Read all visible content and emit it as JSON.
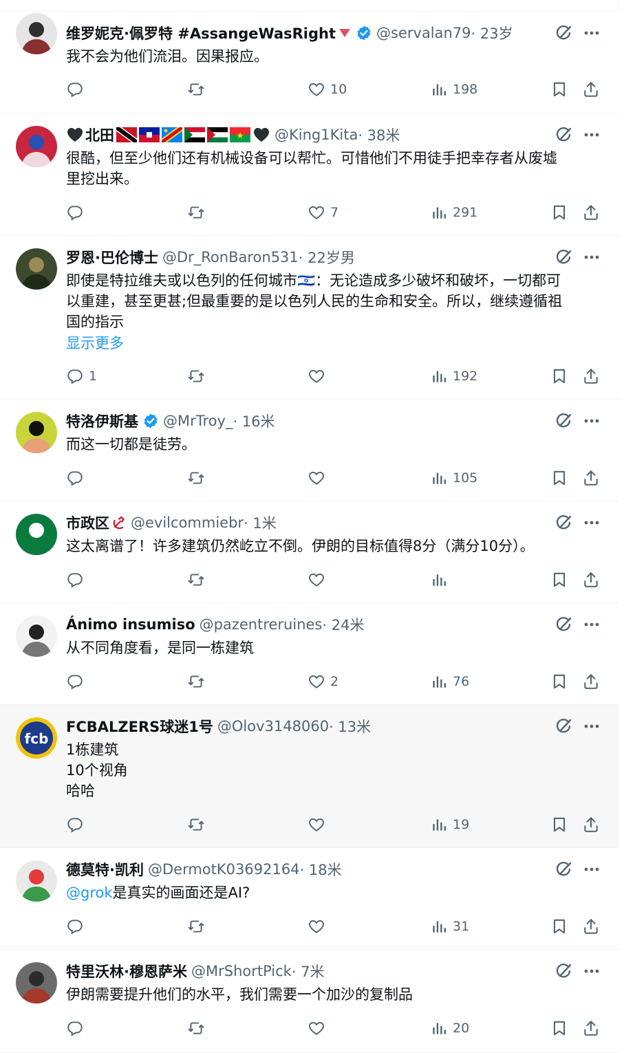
{
  "replies": [
    {
      "name": "维罗妮克·佩罗特 #AssangeWasRight",
      "name_emoji": [
        "red-triangle"
      ],
      "verified": true,
      "handle": "@servalan79",
      "time": " · 23岁",
      "text": "我不会为他们流泪。因果报应。",
      "replies_count": "",
      "likes": "10",
      "views": "198",
      "avatar_colors": [
        "#e5e5e5",
        "#2f2f2f",
        "#8a2f2f"
      ]
    },
    {
      "name_prefix": "🖤",
      "name": "北田",
      "name_emoji": [
        "flag-tt",
        "flag-ht",
        "flag-cd",
        "flag-sd",
        "flag-ps",
        "flag-bf",
        "black-heart"
      ],
      "verified": false,
      "handle": "@King1Kita",
      "time": " · 38米",
      "text": "很酷，但至少他们还有机械设备可以帮忙。可惜他们不用徒手把幸存者从废墟\n里挖出来。",
      "replies_count": "",
      "likes": "7",
      "views": "291",
      "avatar_colors": [
        "#c7263e",
        "#2951b5",
        "#f0d8e0"
      ]
    },
    {
      "name": "罗恩·巴伦博士",
      "verified": false,
      "handle": "@Dr_RonBaron531",
      "time": " · 22岁男",
      "text": "即使是特拉维夫或以色列的任何城市🇮🇱：无论造成多少破坏和破坏，一切都可\n以重建，甚至更甚;但最重要的是以色列人民的生命和安全。所以，继续遵循祖\n国的指示",
      "show_more": "显示更多",
      "replies_count": "1",
      "likes": "",
      "views": "192",
      "avatar_colors": [
        "#3d4a2e",
        "#9a8a55",
        "#1f2a17"
      ]
    },
    {
      "name": "特洛伊斯基",
      "verified": true,
      "handle": "@MrTroy_",
      "time": " · 16米",
      "text": "而这一切都是徒劳。",
      "replies_count": "",
      "likes": "",
      "views": "105",
      "avatar_colors": [
        "#c8d43a",
        "#111111",
        "#e8a077"
      ]
    },
    {
      "name": "市政区",
      "name_emoji": [
        "hammer-sickle"
      ],
      "verified": false,
      "handle": "@evilcommiebr",
      "time": " · 1米",
      "text": "这太离谱了！许多建筑仍然屹立不倒。伊朗的目标值得8分（满分10分）。",
      "replies_count": "",
      "likes": "",
      "views": "",
      "avatar_colors": [
        "#0b7a3e",
        "#ffffff",
        "#0b7a3e"
      ]
    },
    {
      "name": "Ánimo insumiso",
      "verified": false,
      "handle": "@pazentreruines",
      "time": " · 24米",
      "text": "从不同角度看，是同一栋建筑",
      "replies_count": "",
      "likes": "2",
      "views": "76",
      "avatar_colors": [
        "#f2f2f2",
        "#222222",
        "#777777"
      ]
    },
    {
      "name": "FCBALZERS球迷1号",
      "verified": false,
      "handle": "@Olov3148060",
      "time": " · 13米",
      "text": "1栋建筑\n10个视角\n哈哈",
      "replies_count": "",
      "likes": "",
      "views": "19",
      "avatar_colors": [
        "#f4c20d",
        "#1d3b8b",
        "#ffffff"
      ],
      "avatar_text": "fcb"
    },
    {
      "name": "德莫特·凯利",
      "verified": false,
      "handle": "@DermotK03692164",
      "time": " · 18米",
      "mention": "@grok",
      "text": "是真实的画面还是AI?",
      "replies_count": "",
      "likes": "",
      "views": "31",
      "avatar_colors": [
        "#e9e9e9",
        "#e23b3b",
        "#3b9b4a"
      ]
    },
    {
      "name": "特里沃林·穆恩萨米",
      "verified": false,
      "handle": "@MrShortPick",
      "time": " · 7米",
      "text": "伊朗需要提升他们的水平，我们需要一个加沙的复制品",
      "replies_count": "",
      "likes": "",
      "views": "20",
      "avatar_colors": [
        "#6b6b6b",
        "#2b2b2b",
        "#a33a2a"
      ]
    }
  ],
  "icons": {
    "reply": "reply-icon",
    "retweet": "retweet-icon",
    "like": "like-icon",
    "views": "views-icon",
    "bookmark": "bookmark-icon",
    "share": "share-icon",
    "grok": "grok-icon",
    "more": "more-icon"
  },
  "colors": {
    "text": "#0f1419",
    "secondary": "#536471",
    "accent": "#1d9bf0",
    "divider": "#eff3f4",
    "highlight_bg": "#f7f7f7"
  }
}
